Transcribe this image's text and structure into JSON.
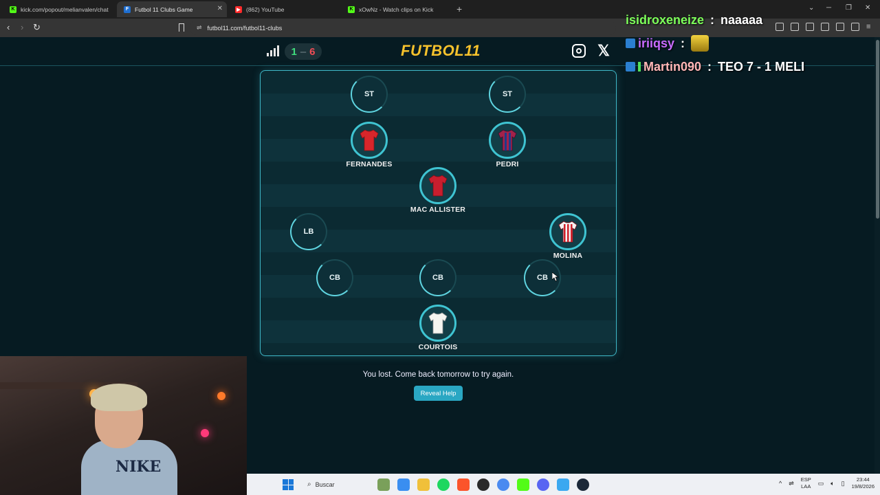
{
  "browser": {
    "tabs": [
      {
        "title": "kick.com/popout/melianvalen/chat",
        "favicon_color": "#53fc18",
        "active": false
      },
      {
        "title": "Futbol 11 Clubs Game",
        "favicon_color": "#1f6fd1",
        "active": true
      },
      {
        "title": "(862) YouTube",
        "favicon_color": "#ff2a2a",
        "active": false
      },
      {
        "title": "xOwNz - Watch clips on Kick",
        "favicon_color": "#53fc18",
        "active": false
      }
    ],
    "url": "futbol11.com/futbol11-clubs"
  },
  "site": {
    "logo": "FUTBOL11",
    "score": {
      "wins": "1",
      "separator": "–",
      "losses": "6"
    },
    "positions": [
      {
        "label": "ST",
        "player": "",
        "filled": false
      },
      {
        "label": "ST",
        "player": "",
        "filled": false
      },
      {
        "label": "",
        "player": "FERNANDES",
        "filled": true,
        "shirt": "red"
      },
      {
        "label": "",
        "player": "PEDRI",
        "filled": true,
        "shirt": "blaugrana"
      },
      {
        "label": "",
        "player": "MAC ALLISTER",
        "filled": true,
        "shirt": "red"
      },
      {
        "label": "LB",
        "player": "",
        "filled": false
      },
      {
        "label": "",
        "player": "MOLINA",
        "filled": true,
        "shirt": "red-white-stripes"
      },
      {
        "label": "CB",
        "player": "",
        "filled": false
      },
      {
        "label": "CB",
        "player": "",
        "filled": false
      },
      {
        "label": "CB",
        "player": "",
        "filled": false
      },
      {
        "label": "",
        "player": "COURTOIS",
        "filled": true,
        "shirt": "white"
      }
    ],
    "message": "You lost. Come back tomorrow to try again.",
    "reveal_button": "Reveal Help"
  },
  "chat": [
    {
      "user": "isidroxeneize",
      "sep": " : ",
      "text": "naaaaa"
    },
    {
      "user": "iriiqsy",
      "sep": " : ",
      "text": ""
    },
    {
      "user": "Martin090",
      "sep": " : ",
      "text": "TEO 7 - 1 MELI"
    }
  ],
  "taskbar": {
    "search_placeholder": "Buscar",
    "lang_top": "ESP",
    "lang_bottom": "LAA",
    "time": "23:44",
    "date": "19/8/2026"
  }
}
